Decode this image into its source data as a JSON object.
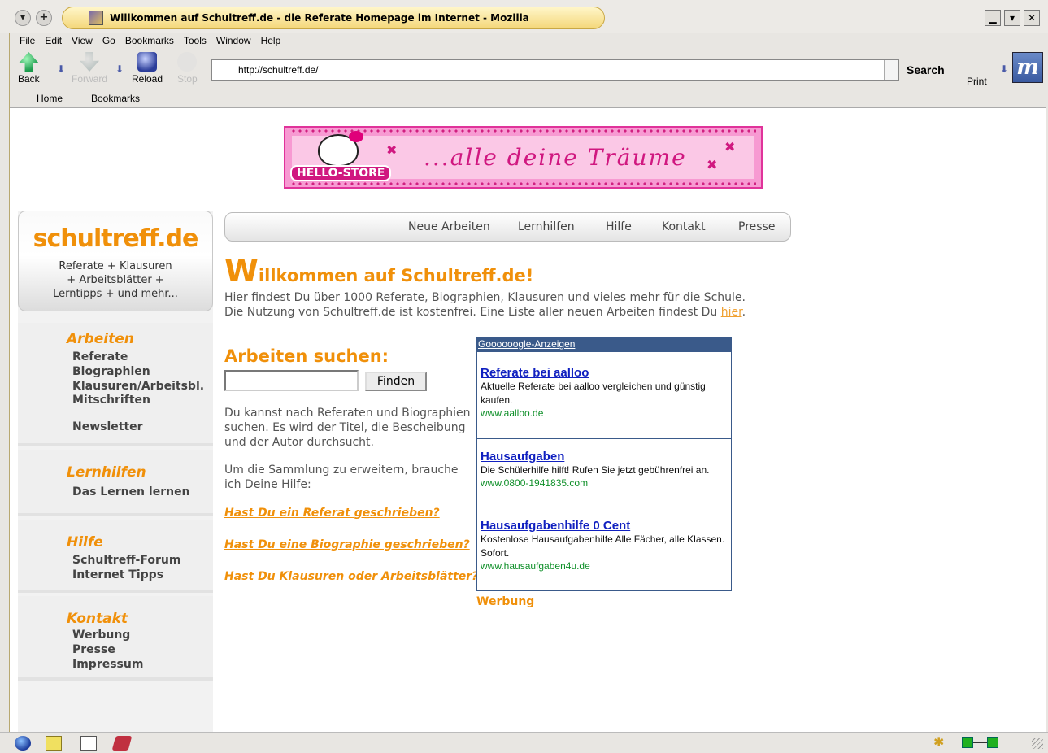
{
  "window": {
    "title": "Willkommen auf Schultreff.de - die Referate Homepage im Internet - Mozilla",
    "left_buttons": [
      "▾",
      "+"
    ],
    "controls": [
      "▁",
      "▾",
      "✕"
    ]
  },
  "menu": [
    "File",
    "Edit",
    "View",
    "Go",
    "Bookmarks",
    "Tools",
    "Window",
    "Help"
  ],
  "toolbar": {
    "back": "Back",
    "forward": "Forward",
    "reload": "Reload",
    "stop": "Stop",
    "url": "http://schultreff.de/",
    "search": "Search",
    "print": "Print",
    "throbber": "m"
  },
  "personal_toolbar": [
    "Home",
    "Bookmarks"
  ],
  "banner": {
    "store": "HELLO-STORE",
    "slogan": "...alle deine Träume"
  },
  "sidebar": {
    "logo": "schultreff.de",
    "tagline": [
      "Referate + Klausuren",
      "+ Arbeitsblätter +",
      "Lerntipps + und mehr..."
    ],
    "sections": [
      {
        "heading": "Arbeiten",
        "links": [
          "Referate",
          "Biographien",
          "Klausuren/Arbeitsbl.",
          "Mitschriften",
          "Newsletter"
        ]
      },
      {
        "heading": "Lernhilfen",
        "links": [
          "Das Lernen lernen"
        ]
      },
      {
        "heading": "Hilfe",
        "links": [
          "Schultreff-Forum",
          "Internet Tipps"
        ]
      },
      {
        "heading": "Kontakt",
        "links": [
          "Werbung",
          "Presse",
          "Impressum"
        ]
      }
    ]
  },
  "topnav": [
    "Neue Arbeiten",
    "Lernhilfen",
    "Hilfe",
    "Kontakt",
    "Presse"
  ],
  "main": {
    "welcome_first": "W",
    "welcome_rest": "illkommen auf Schultreff.de!",
    "intro_line1": "Hier findest Du über 1000 Referate, Biographien, Klausuren und vieles mehr für die Schule.",
    "intro_line2": "Die Nutzung von Schultreff.de ist kostenfrei. Eine Liste aller neuen Arbeiten findest Du ",
    "intro_link": "hier",
    "intro_end": ".",
    "search_heading": "Arbeiten suchen:",
    "search_button": "Finden",
    "search_desc": "Du kannst nach Referaten und Biographien suchen. Es wird der Titel, die Bescheibung und der Autor durchsucht.",
    "help_desc": "Um die Sammlung zu erweitern, brauche ich Deine Hilfe:",
    "questions": [
      "Hast Du ein Referat geschrieben?",
      "Hast Du eine Biographie geschrieben?",
      "Hast Du Klausuren oder Arbeitsblätter?"
    ]
  },
  "ads": {
    "header": "Goooooogle-Anzeigen",
    "items": [
      {
        "title": "Referate bei aalloo",
        "text": "Aktuelle Referate bei aalloo vergleichen und günstig kaufen.",
        "url": "www.aalloo.de"
      },
      {
        "title": "Hausaufgaben",
        "text": "Die Schülerhilfe hilft! Rufen Sie jetzt gebührenfrei an.",
        "url": "www.0800-1941835.com"
      },
      {
        "title": "Hausaufgabenhilfe 0 Cent",
        "text": "Kostenlose Hausaufgabenhilfe Alle Fächer, alle Klassen. Sofort.",
        "url": "www.hausaufgaben4u.de"
      }
    ],
    "footer": "Werbung"
  }
}
